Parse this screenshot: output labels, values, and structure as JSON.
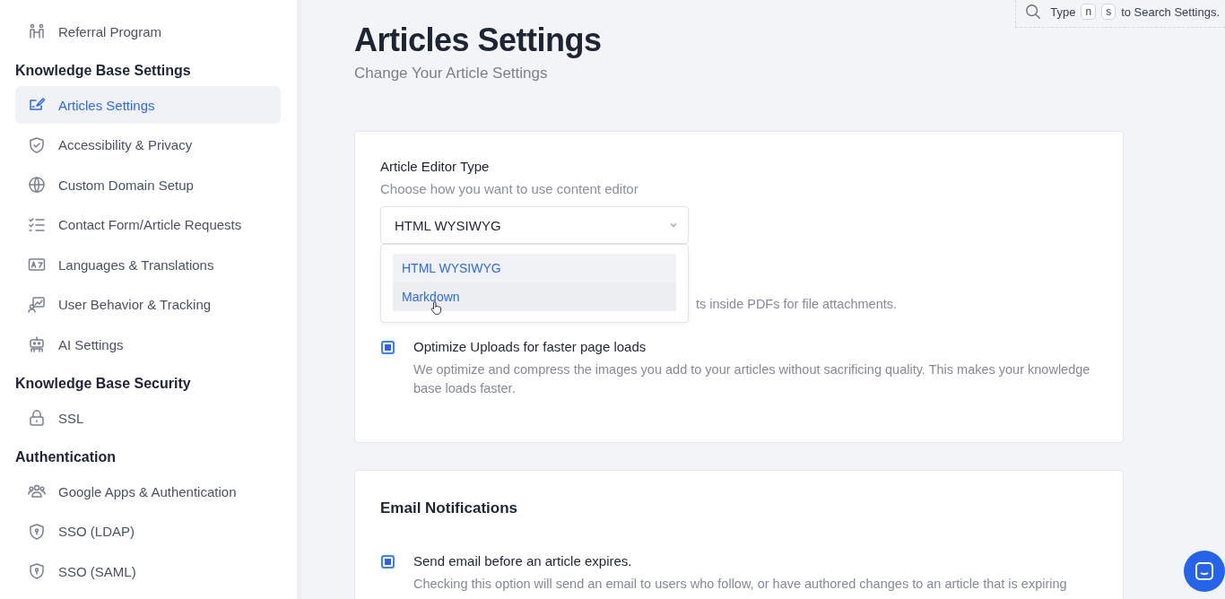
{
  "sidebar": {
    "sections": [
      {
        "items": [
          {
            "label": "Referral Program",
            "selected": false
          }
        ]
      },
      {
        "heading": "Knowledge Base Settings",
        "items": [
          {
            "label": "Articles Settings",
            "selected": true
          },
          {
            "label": "Accessibility & Privacy",
            "selected": false
          },
          {
            "label": "Custom Domain Setup",
            "selected": false
          },
          {
            "label": "Contact Form/Article Requests",
            "selected": false
          },
          {
            "label": "Languages & Translations",
            "selected": false
          },
          {
            "label": "User Behavior & Tracking",
            "selected": false
          },
          {
            "label": "AI Settings",
            "selected": false
          }
        ]
      },
      {
        "heading": "Knowledge Base Security",
        "items": [
          {
            "label": "SSL",
            "selected": false
          }
        ]
      },
      {
        "heading": "Authentication",
        "items": [
          {
            "label": "Google Apps & Authentication",
            "selected": false
          },
          {
            "label": "SSO (LDAP)",
            "selected": false
          },
          {
            "label": "SSO (SAML)",
            "selected": false
          }
        ]
      }
    ]
  },
  "search_hint": {
    "prefix": "Type",
    "keys": [
      "n",
      "s"
    ],
    "suffix": "to Search Settings."
  },
  "page": {
    "title": "Articles Settings",
    "subtitle": "Change Your Article Settings"
  },
  "editor_card": {
    "label": "Article Editor Type",
    "description": "Choose how you want to use content editor",
    "select": {
      "value": "HTML WYSIWYG",
      "expanded": true,
      "options": [
        {
          "label": "HTML WYSIWYG",
          "hovered": false
        },
        {
          "label": "Markdown",
          "hovered": true
        }
      ]
    },
    "options": [
      {
        "kind": "partial",
        "description": "ts inside PDFs for file attachments."
      },
      {
        "kind": "checkbox",
        "title": "Optimize Uploads for faster page loads",
        "description": "We optimize and compress the images you add to your articles without sacrificing quality. This makes your knowledge base loads faster.",
        "checked": true
      }
    ]
  },
  "email_card": {
    "title": "Email Notifications",
    "options": [
      {
        "title": "Send email before an article expires.",
        "description": "Checking this option will send an email to users who follow, or have authored changes to an article that is expiring",
        "checked": true
      }
    ]
  }
}
